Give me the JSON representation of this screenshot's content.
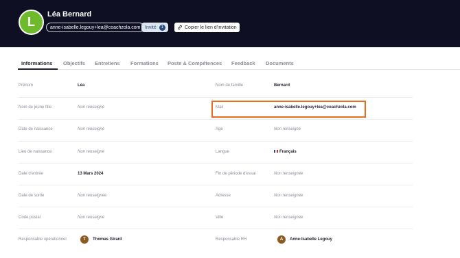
{
  "header": {
    "avatar_letter": "L",
    "name": "Léa Bernard",
    "email": "anne-isabelle.legouy+lea@coachzola.com",
    "invite_label": "Invité",
    "invite_count": "1",
    "copy_link_label": "Copier le lien d'invitation"
  },
  "tabs": [
    "Informations",
    "Objectifs",
    "Entretiens",
    "Formations",
    "Poste & Compétences",
    "Feedback",
    "Documents"
  ],
  "active_tab": "Informations",
  "fields": {
    "prenom": {
      "label": "Prénom",
      "value": "Léa"
    },
    "nom_famille": {
      "label": "Nom de famille",
      "value": "Bernard"
    },
    "nom_jeune_fille": {
      "label": "Nom de jeune fille",
      "value": "Non renseigné"
    },
    "mail": {
      "label": "Mail",
      "value": "anne-isabelle.legouy+lea@coachzola.com"
    },
    "date_naissance": {
      "label": "Date de naissance",
      "value": "Non renseigné"
    },
    "age": {
      "label": "Age",
      "value": "Non renseigné"
    },
    "lieu_naissance": {
      "label": "Lieu de naissance",
      "value": "Non renseigné"
    },
    "langue": {
      "label": "Langue",
      "value": "Français"
    },
    "date_entree": {
      "label": "Date d'entrée",
      "value": "13 Mars 2024"
    },
    "fin_periode": {
      "label": "Fin de période d'essai",
      "value": "Non renseignée"
    },
    "date_sortie": {
      "label": "Date de sortie",
      "value": "Non renseignée"
    },
    "adresse": {
      "label": "Adresse",
      "value": "Non renseignée"
    },
    "code_postal": {
      "label": "Code postal",
      "value": "Non renseigné"
    },
    "ville": {
      "label": "Ville",
      "value": "Non renseignée"
    },
    "responsable_op": {
      "label": "Responsable opérationnel",
      "value": "Thomas Girard",
      "initial": "T"
    },
    "responsable_rh": {
      "label": "Responsable RH",
      "value": "Anne-Isabelle Legouy",
      "initial": "A"
    }
  },
  "colors": {
    "header_bg": "#0f0f23",
    "avatar_green": "#6fba2c",
    "highlight_orange": "#ee6a1c",
    "mini_avatar_brown": "#8b5a1e"
  }
}
